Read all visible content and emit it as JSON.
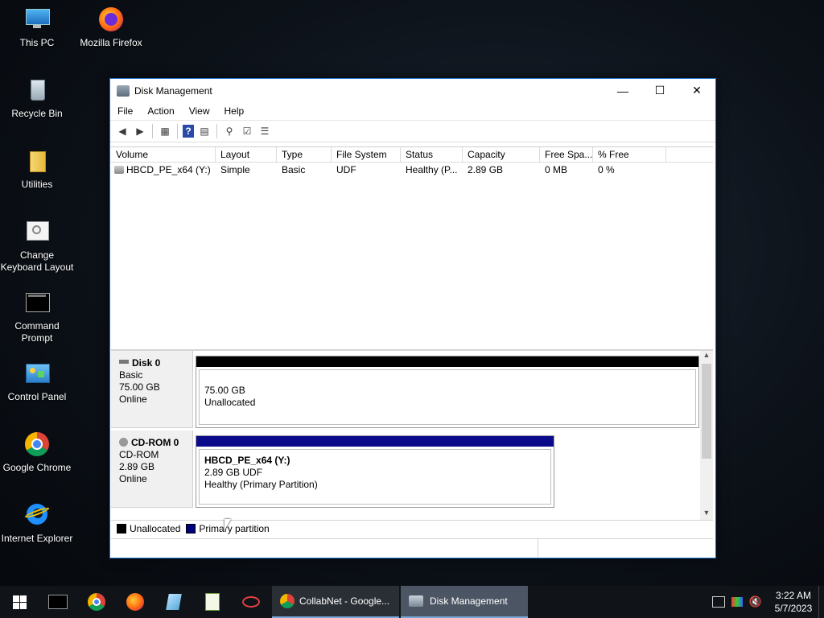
{
  "desktop": {
    "icons": [
      {
        "label": "This PC"
      },
      {
        "label": "Mozilla Firefox"
      },
      {
        "label": "Recycle Bin"
      },
      {
        "label": "Utilities"
      },
      {
        "label": "Change Keyboard Layout"
      },
      {
        "label": "Command Prompt"
      },
      {
        "label": "Control Panel"
      },
      {
        "label": "Google Chrome"
      },
      {
        "label": "Internet Explorer"
      }
    ]
  },
  "window": {
    "title": "Disk Management",
    "minimize": "—",
    "maximize": "☐",
    "close": "✕",
    "menu": [
      "File",
      "Action",
      "View",
      "Help"
    ]
  },
  "volumes": {
    "columns": [
      "Volume",
      "Layout",
      "Type",
      "File System",
      "Status",
      "Capacity",
      "Free Spa...",
      "% Free"
    ],
    "rows": [
      [
        "HBCD_PE_x64 (Y:)",
        "Simple",
        "Basic",
        "UDF",
        "Healthy (P...",
        "2.89 GB",
        "0 MB",
        "0 %"
      ]
    ]
  },
  "disks": [
    {
      "name": "Disk 0",
      "type": "Basic",
      "size": "75.00 GB",
      "status": "Online",
      "partition": {
        "line1": "",
        "line2": "75.00 GB",
        "line3": "Unallocated"
      }
    },
    {
      "name": "CD-ROM 0",
      "type": "CD-ROM",
      "size": "2.89 GB",
      "status": "Online",
      "partition": {
        "line1": "HBCD_PE_x64  (Y:)",
        "line2": "2.89 GB UDF",
        "line3": "Healthy (Primary Partition)"
      }
    }
  ],
  "legend": [
    {
      "label": "Unallocated",
      "color": "#000000"
    },
    {
      "label": "Primary partition",
      "color": "#00007f"
    }
  ],
  "colors": {
    "unallocated": "#000000",
    "primary": "#0a0a8a",
    "title_accent": "#1b6fc7"
  },
  "taskbar": {
    "tasks": [
      {
        "label": "CollabNet - Google..."
      },
      {
        "label": "Disk Management"
      }
    ],
    "time": "3:22 AM",
    "date": "5/7/2023"
  }
}
